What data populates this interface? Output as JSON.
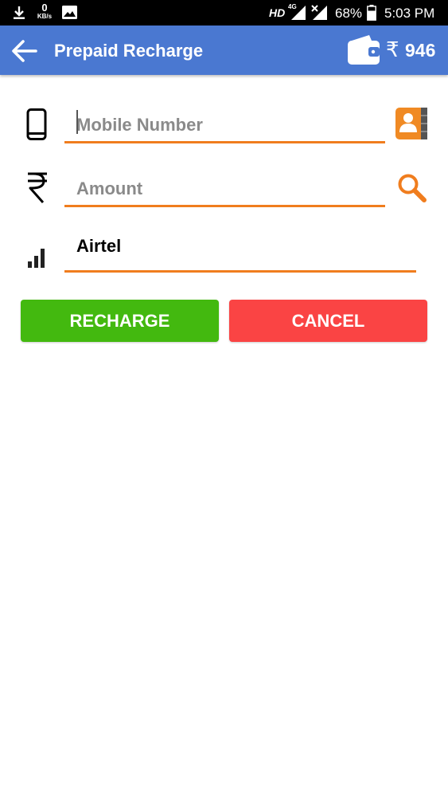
{
  "status_bar": {
    "net_speed_value": "0",
    "net_speed_unit": "KB/s",
    "hd_label": "HD",
    "network_label": "4G",
    "battery_percent": "68%",
    "time": "5:03 PM",
    "icons": [
      "download-icon",
      "image-icon",
      "signal-icon",
      "signal-no-service-icon",
      "battery-icon"
    ]
  },
  "app_bar": {
    "title": "Prepaid Recharge",
    "currency_symbol": "₹",
    "wallet_balance": "946",
    "color": "#4a78d1",
    "icons": [
      "back-arrow-icon",
      "wallet-icon"
    ]
  },
  "form": {
    "mobile": {
      "placeholder": "Mobile Number",
      "value": "",
      "icons": [
        "mobile-phone-icon",
        "contacts-book-icon"
      ]
    },
    "amount": {
      "placeholder": "Amount",
      "value": "",
      "icons": [
        "rupee-icon",
        "search-icon"
      ]
    },
    "operator": {
      "value": "Airtel",
      "icons": [
        "signal-bars-icon"
      ]
    },
    "underline_color": "#f07d1e"
  },
  "buttons": {
    "recharge_label": "RECHARGE",
    "cancel_label": "CANCEL",
    "recharge_color": "#43b90f",
    "cancel_color": "#fa4444"
  }
}
